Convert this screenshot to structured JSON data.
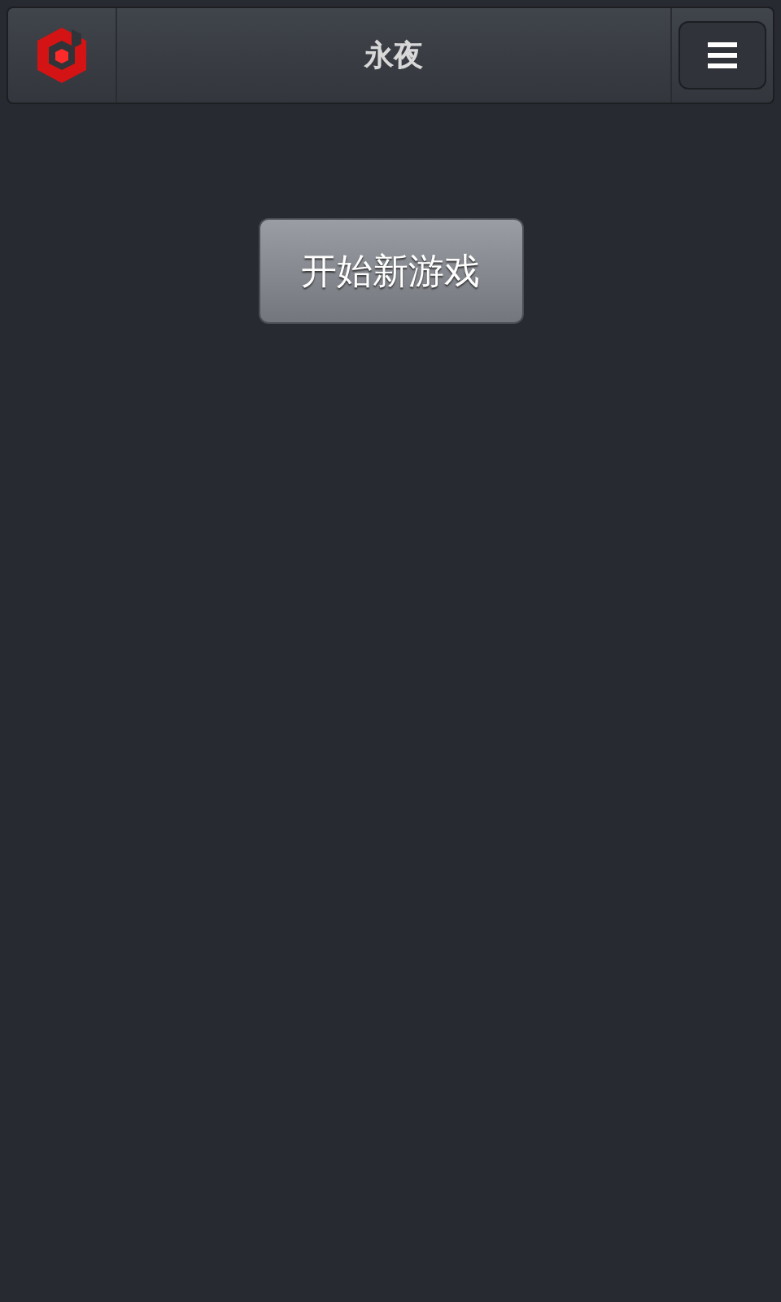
{
  "header": {
    "title": "永夜"
  },
  "buttons": [
    {
      "label": "开始新游戏"
    }
  ]
}
